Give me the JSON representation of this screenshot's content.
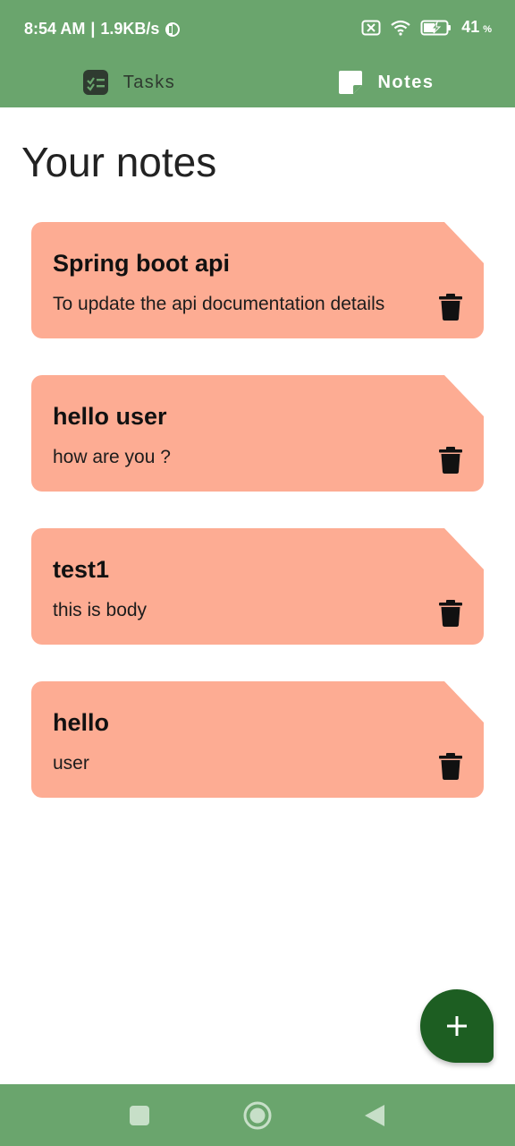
{
  "status_bar": {
    "time": "8:54 AM",
    "separator": "|",
    "speed": "1.9KB/s",
    "battery_percent": "41",
    "battery_unit": "%",
    "icons": [
      "sim-off-icon",
      "wifi-icon",
      "battery-charging-icon",
      "app-notification-icon"
    ]
  },
  "tabs": [
    {
      "label": "Tasks",
      "icon": "checklist-icon",
      "active": false
    },
    {
      "label": "Notes",
      "icon": "note-icon",
      "active": true
    }
  ],
  "page": {
    "title": "Your notes"
  },
  "notes": [
    {
      "title": "Spring boot api",
      "body": "To update the api documentation details"
    },
    {
      "title": "hello user",
      "body": "how are you ?"
    },
    {
      "title": "test1",
      "body": "this is body"
    },
    {
      "title": "hello",
      "body": "user"
    }
  ],
  "fab": {
    "icon": "plus-icon"
  },
  "nav_bar": {
    "icons": [
      "recents-square-icon",
      "home-circle-icon",
      "back-triangle-icon"
    ]
  },
  "colors": {
    "header_green": "#6aa56d",
    "note_salmon": "#fdac93",
    "fab_green": "#1d5e22",
    "nav_green": "#6aa56d"
  }
}
